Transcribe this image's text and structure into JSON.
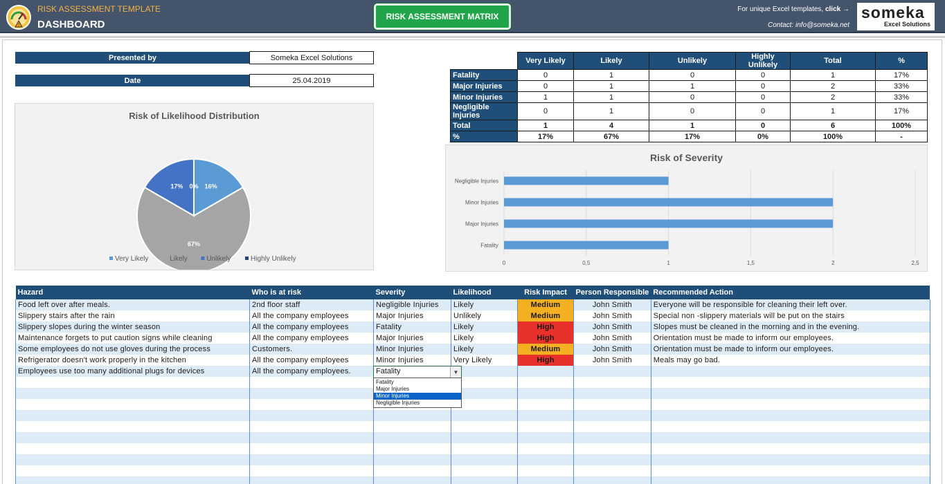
{
  "header": {
    "app_title": "RISK ASSESSMENT TEMPLATE",
    "page_title": "DASHBOARD",
    "matrix_button": "RISK ASSESSMENT MATRIX",
    "promo_text": "For unique Excel templates,",
    "promo_link": "click →",
    "contact": "Contact: info@someka.net",
    "brand": "someka",
    "brand_sub": "Excel Solutions",
    "colors": {
      "header_bg": "#44546a",
      "title_accent": "#f4b24a",
      "button_green": "#21a54a"
    }
  },
  "info": {
    "presented_by_label": "Presented by",
    "presented_by_value": "Someka Excel Solutions",
    "date_label": "Date",
    "date_value": "25.04.2019"
  },
  "summary_table": {
    "headers": [
      "Very Likely",
      "Likely",
      "Unlikely",
      "Highly Unlikely",
      "Total",
      "%"
    ],
    "rows": [
      {
        "label": "Fatality",
        "values": [
          "0",
          "1",
          "0",
          "0",
          "1",
          "17%"
        ]
      },
      {
        "label": "Major Injuries",
        "values": [
          "0",
          "1",
          "1",
          "0",
          "2",
          "33%"
        ]
      },
      {
        "label": "Minor Injuries",
        "values": [
          "1",
          "1",
          "0",
          "0",
          "2",
          "33%"
        ]
      },
      {
        "label": "Negligible Injuries",
        "values": [
          "0",
          "1",
          "0",
          "0",
          "1",
          "17%"
        ]
      },
      {
        "label": "Total",
        "values": [
          "1",
          "4",
          "1",
          "0",
          "6",
          "100%"
        ]
      },
      {
        "label": "%",
        "values": [
          "17%",
          "67%",
          "17%",
          "0%",
          "100%",
          "-"
        ]
      }
    ]
  },
  "chart_data": [
    {
      "type": "pie",
      "title": "Risk of Likelihood Distribution",
      "categories": [
        "Very Likely",
        "Likely",
        "Unlikely",
        "Highly Unlikely"
      ],
      "values": [
        1,
        4,
        1,
        0
      ],
      "data_labels": [
        "16%",
        "67%",
        "17%",
        "0%"
      ],
      "colors": [
        "#5b9bd5",
        "#a5a5a5",
        "#4472c4",
        "#264478"
      ],
      "legend": "bottom"
    },
    {
      "type": "bar",
      "orientation": "horizontal",
      "title": "Risk of Severity",
      "categories": [
        "Negligible Injuries",
        "Minor Injuries",
        "Major Injuries",
        "Fatality"
      ],
      "values": [
        1,
        2,
        2,
        1
      ],
      "xlim": [
        0,
        2.5
      ],
      "xticks": [
        "0",
        "0,5",
        "1",
        "1,5",
        "2",
        "2,5"
      ],
      "grid": true,
      "color": "#5b9bd5"
    }
  ],
  "risk_table": {
    "headers": [
      "Hazard",
      "Who is at risk",
      "Severity",
      "Likelihood",
      "Risk Impact",
      "Person Responsible",
      "Recommended Action"
    ],
    "rows": [
      {
        "hazard": "Food left over after meals.",
        "who": "2nd floor staff",
        "severity": "Negligible Injuries",
        "likelihood": "Likely",
        "impact": "Medium",
        "person": "John Smith",
        "action": "Everyone will be responsible for cleaning their left over."
      },
      {
        "hazard": "Slippery stairs after the rain",
        "who": "All the company employees",
        "severity": "Major Injuries",
        "likelihood": "Unlikely",
        "impact": "Medium",
        "person": "John Smith",
        "action": "Special non -slippery materials will be put on the stairs"
      },
      {
        "hazard": "Slippery slopes during the winter season",
        "who": "All the company employees",
        "severity": "Fatality",
        "likelihood": "Likely",
        "impact": "High",
        "person": "John Smith",
        "action": "Slopes must be cleaned in the morning and in the evening."
      },
      {
        "hazard": "Maintenance forgets to put caution signs while cleaning",
        "who": "All the company employees",
        "severity": "Major Injuries",
        "likelihood": "Likely",
        "impact": "High",
        "person": "John Smith",
        "action": "Orientation must be made to inform our employees."
      },
      {
        "hazard": "Some employees do not use gloves during the process",
        "who": "Customers.",
        "severity": "Minor Injuries",
        "likelihood": "Likely",
        "impact": "Medium",
        "person": "John Smith",
        "action": "Orientation must be made to inform our employees."
      },
      {
        "hazard": "Refrigerator doesn't work properly in the kitchen",
        "who": "All the company employees",
        "severity": "Minor Injuries",
        "likelihood": "Very Likely",
        "impact": "High",
        "person": "John Smith",
        "action": "Meals may go bad."
      },
      {
        "hazard": "Employees use too many additional plugs for  devices",
        "who": "All the company employees.",
        "severity": "",
        "likelihood": "",
        "impact": "",
        "person": "",
        "action": ""
      }
    ],
    "empty_rows": 10,
    "impact_colors": {
      "Medium": "#f5b022",
      "High": "#e8312a"
    }
  },
  "severity_dropdown": {
    "value": "Fatality",
    "options": [
      "Fatality",
      "Major Injuries",
      "Minor Injuries",
      "Negligible Injuries"
    ],
    "highlighted": "Minor Injuries"
  }
}
